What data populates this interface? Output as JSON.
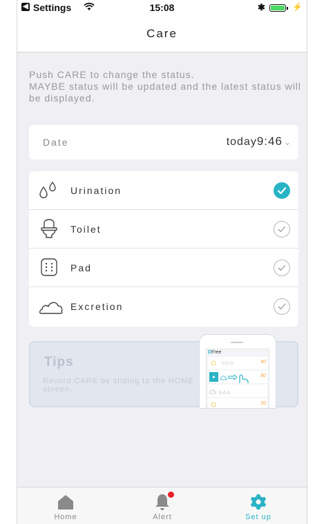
{
  "status_bar": {
    "back_app": "Settings",
    "time": "15:08"
  },
  "nav": {
    "title": "Care"
  },
  "intro_text": "Push CARE to change the status.\nMAYBE status will be updated and the latest status will be displayed.",
  "date": {
    "label": "Date",
    "day": "today",
    "time": "9:46"
  },
  "care_items": [
    {
      "label": "Urination",
      "icon": "drops-icon",
      "checked": true
    },
    {
      "label": "Toilet",
      "icon": "toilet-icon",
      "checked": false
    },
    {
      "label": "Pad",
      "icon": "pad-icon",
      "checked": false
    },
    {
      "label": "Excretion",
      "icon": "excretion-icon",
      "checked": false
    }
  ],
  "tips": {
    "title": "Tips",
    "description": "Record CARE by sliding to the HOME screen.",
    "phone": {
      "brand_d": "D",
      "brand_rest": "Free",
      "rows": [
        "40",
        "80",
        "20"
      ]
    }
  },
  "tabs": [
    {
      "label": "Home",
      "icon": "home-icon",
      "active": false
    },
    {
      "label": "Alert",
      "icon": "bell-icon",
      "active": false,
      "badge": true
    },
    {
      "label": "Set up",
      "icon": "gear-icon",
      "active": true
    }
  ],
  "colors": {
    "accent": "#2ab3c6",
    "badge": "#e8202a",
    "background": "#efeff4"
  }
}
